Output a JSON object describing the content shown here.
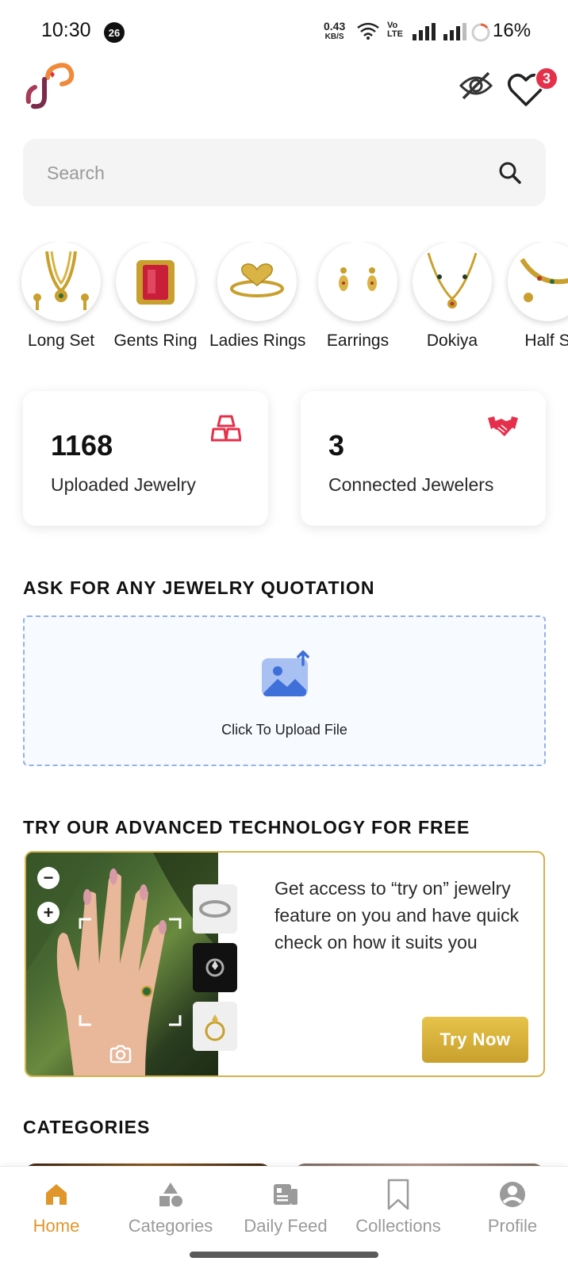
{
  "status_bar": {
    "time": "10:30",
    "notification_count": "26",
    "net_speed_value": "0.43",
    "net_speed_unit": "KB/S",
    "volte_line1": "Vo",
    "volte_line2": "LTE",
    "battery": "16%"
  },
  "header": {
    "wishlist_count": "3",
    "logo_color": "#e3343e"
  },
  "search": {
    "placeholder": "Search"
  },
  "story_categories": [
    {
      "label": "Long Set"
    },
    {
      "label": "Gents Ring"
    },
    {
      "label": "Ladies Rings"
    },
    {
      "label": "Earrings"
    },
    {
      "label": "Dokiya"
    },
    {
      "label": "Half S"
    }
  ],
  "stats": {
    "uploaded": {
      "value": "1168",
      "label": "Uploaded Jewelry"
    },
    "connected": {
      "value": "3",
      "label": "Connected Jewelers"
    }
  },
  "quotation": {
    "title": "ASK FOR ANY JEWELRY QUOTATION",
    "upload_label": "Click To Upload File"
  },
  "tryon": {
    "title": "TRY OUR ADVANCED TECHNOLOGY FOR FREE",
    "description": "Get access to “try on” jewelry feature on you and have quick check on how it suits you",
    "button_label": "Try Now"
  },
  "categories_section": {
    "title": "CATEGORIES"
  },
  "bottom_nav": [
    {
      "label": "Home",
      "icon": "home-icon",
      "active": true
    },
    {
      "label": "Categories",
      "icon": "shapes-icon",
      "active": false
    },
    {
      "label": "Daily Feed",
      "icon": "feed-icon",
      "active": false
    },
    {
      "label": "Collections",
      "icon": "bookmark-icon",
      "active": false
    },
    {
      "label": "Profile",
      "icon": "profile-icon",
      "active": false
    }
  ],
  "colors": {
    "accent": "#e0962a",
    "brand_red": "#e5304b",
    "gold": "#d4b24c"
  }
}
